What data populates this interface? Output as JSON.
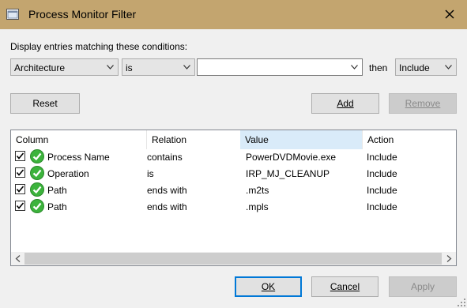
{
  "window": {
    "title": "Process Monitor Filter"
  },
  "conditions_label": "Display entries matching these conditions:",
  "filter": {
    "column": "Architecture",
    "relation": "is",
    "value": "",
    "then_label": "then",
    "action": "Include"
  },
  "buttons": {
    "reset": "Reset",
    "add": "Add",
    "remove": "Remove",
    "ok": "OK",
    "cancel": "Cancel",
    "apply": "Apply"
  },
  "table": {
    "headers": [
      "Column",
      "Relation",
      "Value",
      "Action"
    ],
    "rows": [
      {
        "checked": true,
        "column": "Process Name",
        "relation": "contains",
        "value": "PowerDVDMovie.exe",
        "action": "Include"
      },
      {
        "checked": true,
        "column": "Operation",
        "relation": "is",
        "value": "IRP_MJ_CLEANUP",
        "action": "Include"
      },
      {
        "checked": true,
        "column": "Path",
        "relation": "ends with",
        "value": ".m2ts",
        "action": "Include"
      },
      {
        "checked": true,
        "column": "Path",
        "relation": "ends with",
        "value": ".mpls",
        "action": "Include"
      }
    ]
  },
  "colors": {
    "titlebar": "#c3a56f",
    "accent": "#0078d7",
    "sorted_header": "#d9ebf9",
    "check_green": "#3cb33c"
  },
  "icons": [
    "app-icon",
    "close-icon",
    "checkbox-icon",
    "include-check-icon",
    "chevron-down-icon",
    "scroll-left-icon",
    "scroll-right-icon",
    "resize-grip-icon"
  ]
}
